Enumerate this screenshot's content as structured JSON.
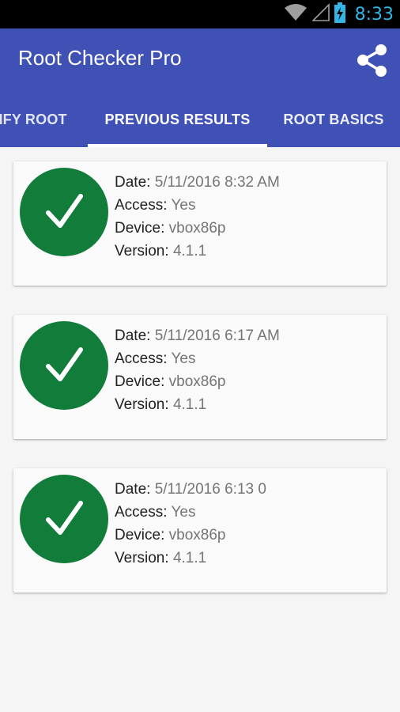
{
  "status_bar": {
    "time": "8:33",
    "icons": [
      "wifi-icon",
      "signal-icon",
      "battery-charging-icon"
    ]
  },
  "app_bar": {
    "title": "Root Checker Pro",
    "action_icon": "share-icon"
  },
  "tabs": [
    {
      "label": "VERIFY ROOT",
      "visible_text": "RIFY ROOT"
    },
    {
      "label": "PREVIOUS RESULTS",
      "active": true
    },
    {
      "label": "ROOT BASICS"
    }
  ],
  "labels": {
    "date": "Date:",
    "access": "Access:",
    "device": "Device:",
    "version": "Version:"
  },
  "results": [
    {
      "date": "5/11/2016  8:32 AM",
      "access": "Yes",
      "device": "vbox86p",
      "version": "4.1.1",
      "status_icon": "checkmark-icon"
    },
    {
      "date": "5/11/2016  6:17 AM",
      "access": "Yes",
      "device": "vbox86p",
      "version": "4.1.1",
      "status_icon": "checkmark-icon"
    },
    {
      "date": "5/11/2016  6:13 0",
      "access": "Yes",
      "device": "vbox86p",
      "version": "4.1.1",
      "status_icon": "checkmark-icon"
    }
  ],
  "colors": {
    "primary": "#3f51b5",
    "success": "#127c3b",
    "clock": "#33b5e5"
  }
}
